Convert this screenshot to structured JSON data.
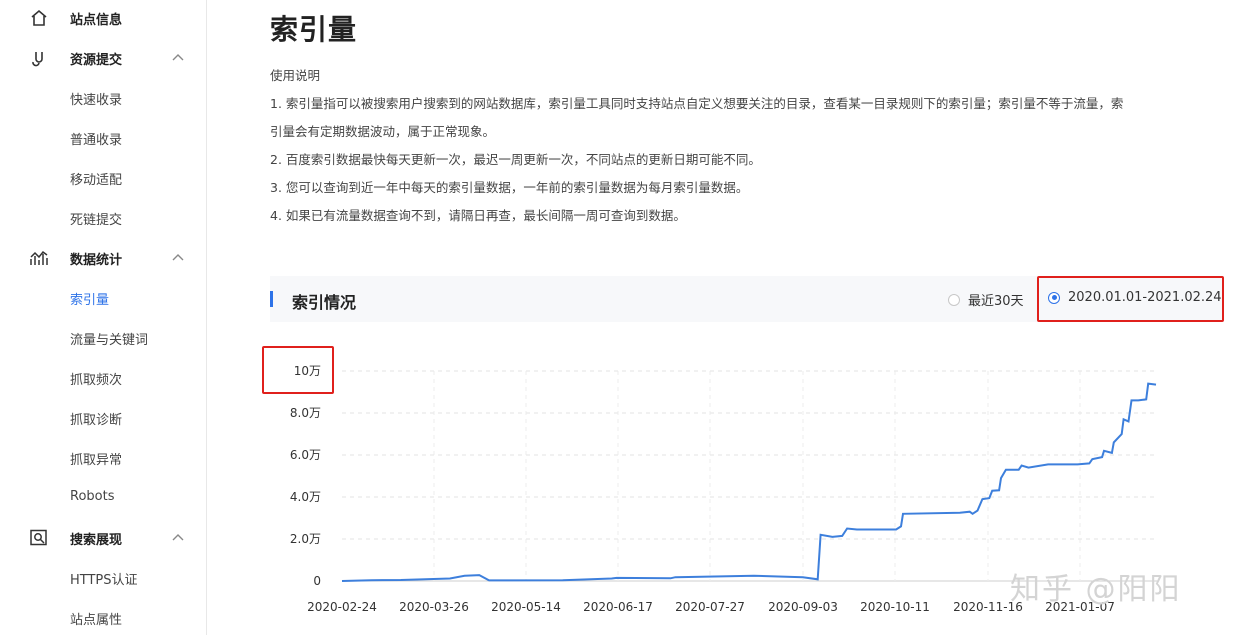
{
  "sidebar": {
    "groups": [
      {
        "label": "站点信息",
        "icon": "home-icon"
      },
      {
        "label": "资源提交",
        "icon": "link-icon",
        "items": [
          "快速收录",
          "普通收录",
          "移动适配",
          "死链提交"
        ]
      },
      {
        "label": "数据统计",
        "icon": "stats-icon",
        "items": [
          "索引量",
          "流量与关键词",
          "抓取频次",
          "抓取诊断",
          "抓取异常",
          "Robots"
        ]
      },
      {
        "label": "搜索展现",
        "icon": "search-display-icon",
        "items": [
          "HTTPS认证",
          "站点属性"
        ]
      }
    ],
    "active_item": "索引量"
  },
  "page": {
    "title": "索引量",
    "usage_heading": "使用说明",
    "usage_lines": [
      "1. 索引量指可以被搜索用户搜索到的网站数据库，索引量工具同时支持站点自定义想要关注的目录，查看某一目录规则下的索引量；索引量不等于流量，索",
      "引量会有定期数据波动，属于正常现象。",
      "2. 百度索引数据最快每天更新一次，最迟一周更新一次，不同站点的更新日期可能不同。",
      "3. 您可以查询到近一年中每天的索引量数据，一年前的索引量数据为每月索引量数据。",
      "4. 如果已有流量数据查询不到，请隔日再查，最长间隔一周可查询到数据。"
    ]
  },
  "section": {
    "title": "索引情况",
    "range_options": [
      "最近30天",
      "2020.01.01-2021.02.24"
    ],
    "selected_range": "2020.01.01-2021.02.24"
  },
  "colors": {
    "accent": "#2e73e8",
    "highlight": "#e0201c",
    "line": "#3d7fdc"
  },
  "chart_data": {
    "type": "line",
    "y_ticks": [
      "0",
      "2.0万",
      "4.0万",
      "6.0万",
      "8.0万",
      "10万"
    ],
    "ylim": [
      0,
      100000
    ],
    "x_ticks": [
      "2020-02-24",
      "2020-03-26",
      "2020-05-14",
      "2020-06-17",
      "2020-07-27",
      "2020-09-03",
      "2020-10-11",
      "2020-11-16",
      "2021-01-07"
    ],
    "grid": true,
    "series": [
      {
        "values": [
          [
            0,
            0
          ],
          [
            30,
            400
          ],
          [
            60,
            500
          ],
          [
            110,
            1200
          ],
          [
            125,
            2500
          ],
          [
            140,
            2800
          ],
          [
            150,
            300
          ],
          [
            225,
            400
          ],
          [
            275,
            1200
          ],
          [
            280,
            1500
          ],
          [
            335,
            1300
          ],
          [
            340,
            1800
          ],
          [
            420,
            2500
          ],
          [
            470,
            1800
          ],
          [
            485,
            800
          ],
          [
            488,
            22000
          ],
          [
            500,
            21000
          ],
          [
            510,
            21500
          ],
          [
            515,
            25000
          ],
          [
            525,
            24500
          ],
          [
            565,
            24500
          ],
          [
            570,
            26000
          ],
          [
            572,
            32000
          ],
          [
            630,
            32500
          ],
          [
            640,
            33000
          ],
          [
            643,
            32000
          ],
          [
            648,
            33500
          ],
          [
            653,
            39000
          ],
          [
            660,
            39500
          ],
          [
            663,
            43000
          ],
          [
            670,
            43200
          ],
          [
            672,
            49000
          ],
          [
            677,
            53000
          ],
          [
            690,
            53000
          ],
          [
            693,
            55000
          ],
          [
            700,
            54000
          ],
          [
            720,
            55500
          ],
          [
            750,
            55500
          ],
          [
            762,
            56000
          ],
          [
            765,
            58000
          ],
          [
            775,
            59000
          ],
          [
            777,
            62000
          ],
          [
            785,
            61000
          ],
          [
            787,
            66000
          ],
          [
            795,
            70000
          ],
          [
            797,
            77000
          ],
          [
            802,
            76000
          ],
          [
            805,
            86000
          ],
          [
            812,
            86000
          ],
          [
            820,
            86500
          ],
          [
            822,
            94000
          ],
          [
            830,
            93500
          ]
        ]
      }
    ]
  },
  "watermark": "知乎 @阳阳"
}
